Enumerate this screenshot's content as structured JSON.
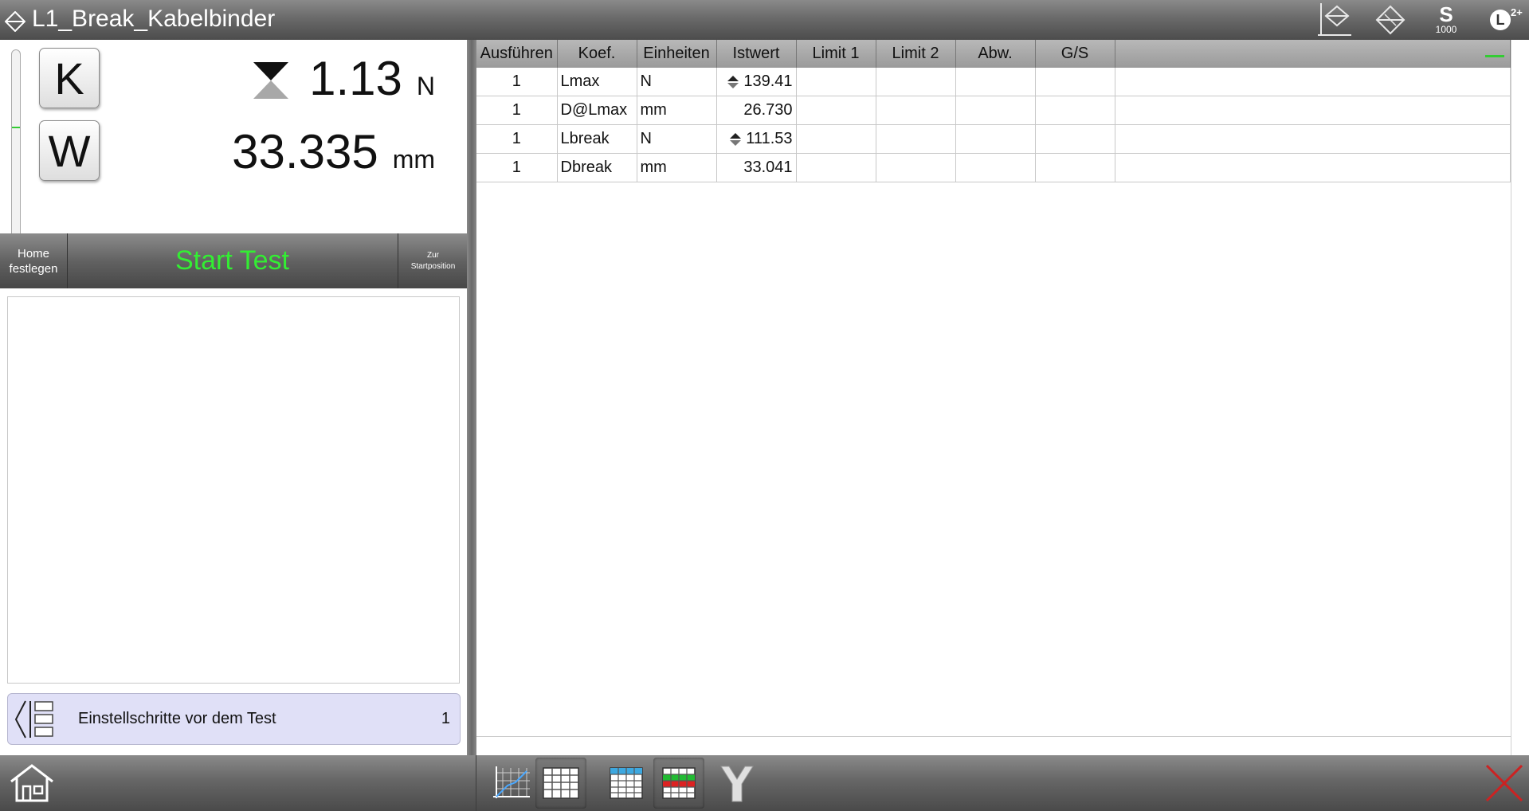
{
  "window": {
    "title": "L1_Break_Kabelbinder"
  },
  "toolbar": {
    "speed_value": "1000",
    "user_level": "L",
    "user_level_sup": "2+"
  },
  "readings": {
    "force": {
      "value": "1.13",
      "unit": "N"
    },
    "distance": {
      "value": "33.335",
      "unit": "mm"
    }
  },
  "buttons": {
    "k_label": "K",
    "w_label": "W",
    "home_set_line1": "Home",
    "home_set_line2": "festlegen",
    "start_test": "Start Test",
    "start_pos_line1": "Zur",
    "start_pos_line2": "Startposition"
  },
  "settings_row": {
    "label": "Einstellschritte vor dem Test",
    "count": "1"
  },
  "table": {
    "headers": [
      "Ausführen",
      "Koef.",
      "Einheiten",
      "Istwert",
      "Limit 1",
      "Limit 2",
      "Abw.",
      "G/S"
    ],
    "rows": [
      {
        "run": "1",
        "coef": "Lmax",
        "unit": "N",
        "value": "139.41",
        "marker": true
      },
      {
        "run": "1",
        "coef": "D@Lmax",
        "unit": "mm",
        "value": "26.730",
        "marker": false
      },
      {
        "run": "1",
        "coef": "Lbreak",
        "unit": "N",
        "value": "111.53",
        "marker": true
      },
      {
        "run": "1",
        "coef": "Dbreak",
        "unit": "mm",
        "value": "33.041",
        "marker": false
      }
    ]
  },
  "colors": {
    "start_test": "#33ee33",
    "progress_mark": "#33cc33",
    "settings_bg": "#e0e0f7",
    "close_red": "#cc2222"
  },
  "icons": [
    "diamond-arrows-icon",
    "axis-plane-icon",
    "crosshair-diamond-icon",
    "speed-icon",
    "user-level-icon",
    "hourglass-icon",
    "settings-list-icon",
    "home-icon",
    "graph-view-icon",
    "table-view-icon",
    "blue-table-icon",
    "colored-table-icon",
    "y-split-icon",
    "close-icon"
  ]
}
